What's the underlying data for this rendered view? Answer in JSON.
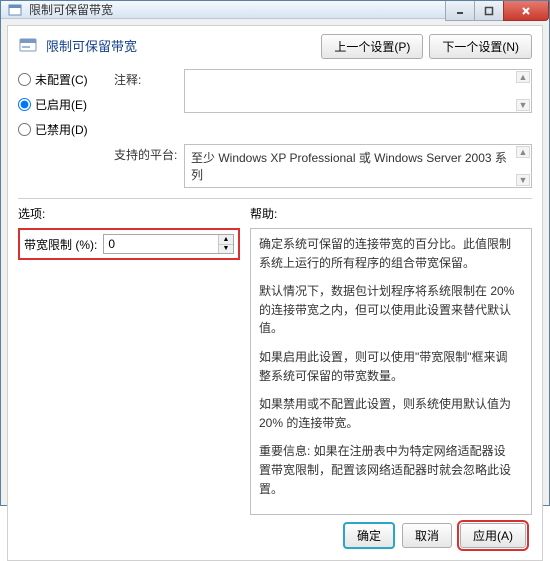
{
  "window": {
    "title": "限制可保留带宽",
    "controls": {
      "min": "minimize",
      "max": "maximize",
      "close": "close"
    }
  },
  "header": {
    "policy_title": "限制可保留带宽",
    "prev_btn": "上一个设置(P)",
    "next_btn": "下一个设置(N)"
  },
  "config": {
    "radios": {
      "not_configured": "未配置(C)",
      "enabled": "已启用(E)",
      "disabled": "已禁用(D)",
      "selected": "enabled"
    },
    "comment_label": "注释:",
    "comment_value": "",
    "platform_label": "支持的平台:",
    "platform_value": "至少 Windows XP Professional 或 Windows Server 2003 系列"
  },
  "options": {
    "section_label": "选项:",
    "help_label": "帮助:",
    "bandwidth_label": "带宽限制 (%):",
    "bandwidth_value": "0"
  },
  "help": {
    "p1": "确定系统可保留的连接带宽的百分比。此值限制系统上运行的所有程序的组合带宽保留。",
    "p2": "默认情况下，数据包计划程序将系统限制在 20% 的连接带宽之内，但可以使用此设置来替代默认值。",
    "p3": "如果启用此设置，则可以使用\"带宽限制\"框来调整系统可保留的带宽数量。",
    "p4": "如果禁用或不配置此设置，则系统使用默认值为 20% 的连接带宽。",
    "p5": "重要信息: 如果在注册表中为特定网络适配器设置带宽限制，配置该网络适配器时就会忽略此设置。"
  },
  "footer": {
    "ok": "确定",
    "cancel": "取消",
    "apply": "应用(A)"
  }
}
